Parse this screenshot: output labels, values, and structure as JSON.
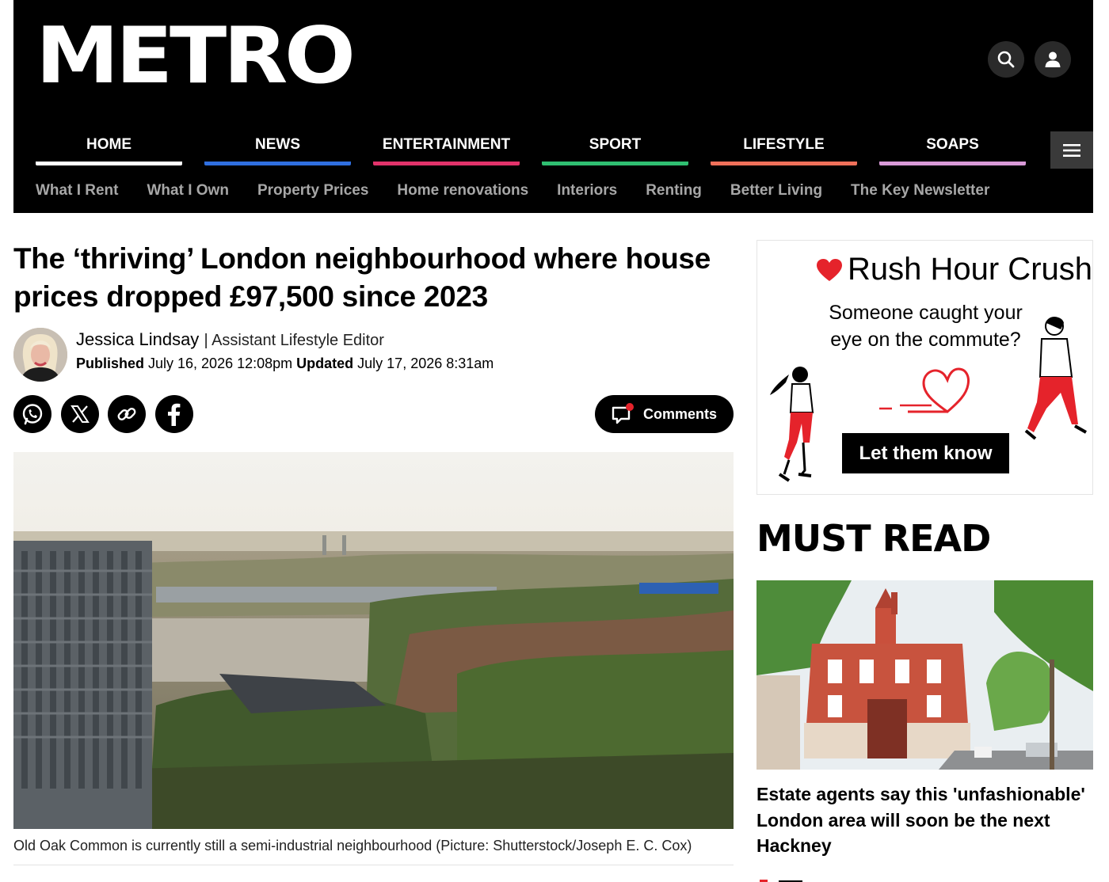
{
  "site": {
    "logo": "METRO"
  },
  "header": {
    "search_icon": "search-icon",
    "user_icon": "user-icon",
    "menu_icon": "hamburger-icon"
  },
  "main_nav": [
    {
      "label": "HOME",
      "color": "#ffffff"
    },
    {
      "label": "NEWS",
      "color": "#2f6fe0"
    },
    {
      "label": "ENTERTAINMENT",
      "color": "#e2336b"
    },
    {
      "label": "SPORT",
      "color": "#2fbf71"
    },
    {
      "label": "LIFESTYLE",
      "color": "#f0705a"
    },
    {
      "label": "SOAPS",
      "color": "#d99ad8"
    }
  ],
  "sub_nav": [
    "What I Rent",
    "What I Own",
    "Property Prices",
    "Home renovations",
    "Interiors",
    "Renting",
    "Better Living",
    "The Key Newsletter"
  ],
  "article": {
    "headline": "The ‘thriving’ London neighbourhood where house prices dropped £97,500 since 2023",
    "author_name": "Jessica Lindsay",
    "author_role": "| Assistant Lifestyle Editor",
    "published_label": "Published",
    "published_value": " July 16, 2026 12:08pm ",
    "updated_label": "Updated",
    "updated_value": " July 17, 2026 8:31am",
    "comments_label": "Comments",
    "caption": "Old Oak Common is currently still a semi-industrial neighbourhood (Picture: Shutterstock/Joseph E. C. Cox)"
  },
  "share_icons": [
    "whatsapp-icon",
    "x-icon",
    "link-icon",
    "facebook-icon"
  ],
  "ad": {
    "title": "Rush Hour Crush",
    "text": "Someone caught your eye on the commute?",
    "cta": "Let them know",
    "heart_color": "#e5232b"
  },
  "sidebar": {
    "must_read": "MUST READ",
    "story_title": "Estate agents say this 'unfashionable' London area will soon be the next Hackney"
  }
}
